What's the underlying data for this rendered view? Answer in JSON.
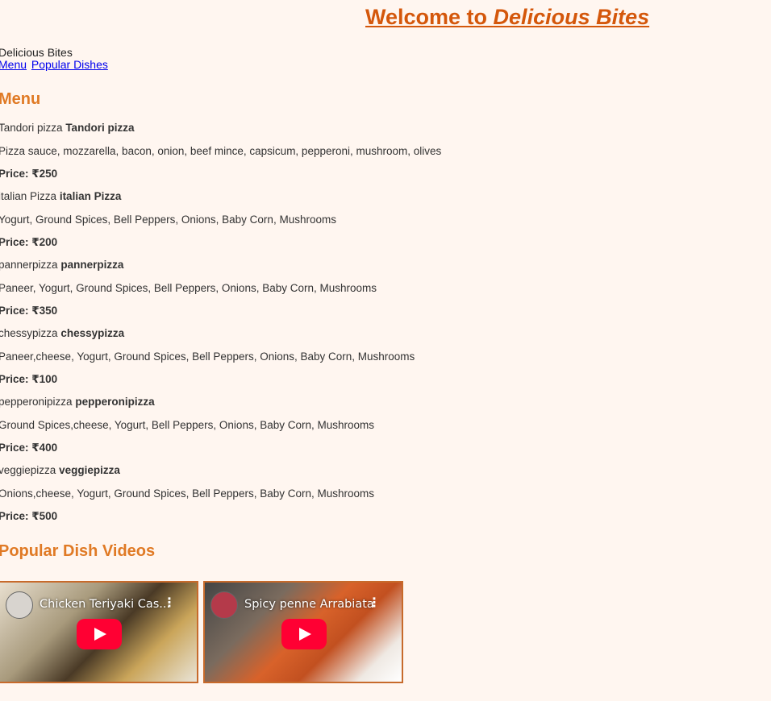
{
  "header": {
    "title_prefix": "Welcome to ",
    "title_brand": "Delicious Bites"
  },
  "brand_text": "Delicious Bites",
  "nav": {
    "menu_link": "Menu",
    "popular_link": "Popular Dishes"
  },
  "menu": {
    "heading": "Menu",
    "dishes": [
      {
        "alt": "Tandori pizza",
        "name": "Tandori pizza",
        "desc": "Pizza sauce, mozzarella, bacon, onion, beef mince, capsicum, pepperoni, mushroom, olives",
        "price": "Price: ₹250"
      },
      {
        "alt": "italian Pizza",
        "name": "italian Pizza",
        "desc": "Yogurt, Ground Spices, Bell Peppers, Onions, Baby Corn, Mushrooms",
        "price": "Price: ₹200"
      },
      {
        "alt": "pannerpizza",
        "name": "pannerpizza",
        "desc": "Paneer, Yogurt, Ground Spices, Bell Peppers, Onions, Baby Corn, Mushrooms",
        "price": "Price: ₹350"
      },
      {
        "alt": "chessypizza",
        "name": "chessypizza",
        "desc": "Paneer,cheese, Yogurt, Ground Spices, Bell Peppers, Onions, Baby Corn, Mushrooms",
        "price": "Price: ₹100"
      },
      {
        "alt": "pepperonipizza",
        "name": "pepperonipizza",
        "desc": "Ground Spices,cheese, Yogurt, Bell Peppers, Onions, Baby Corn, Mushrooms",
        "price": "Price: ₹400"
      },
      {
        "alt": "veggiepizza",
        "name": "veggiepizza",
        "desc": "Onions,cheese, Yogurt, Ground Spices, Bell Peppers, Baby Corn, Mushrooms",
        "price": "Price: ₹500"
      }
    ]
  },
  "videos": {
    "heading": "Popular Dish Videos",
    "items": [
      {
        "title": "Chicken Teriyaki Cas...",
        "menu_glyph": "⋮"
      },
      {
        "title": "Spicy penne Arrabiata",
        "menu_glyph": "⋮"
      }
    ]
  },
  "colors": {
    "background": "#fff6f0",
    "title": "#d4570b",
    "heading": "#e07a25",
    "link": "#0000ee",
    "play_button": "#ff0033"
  }
}
